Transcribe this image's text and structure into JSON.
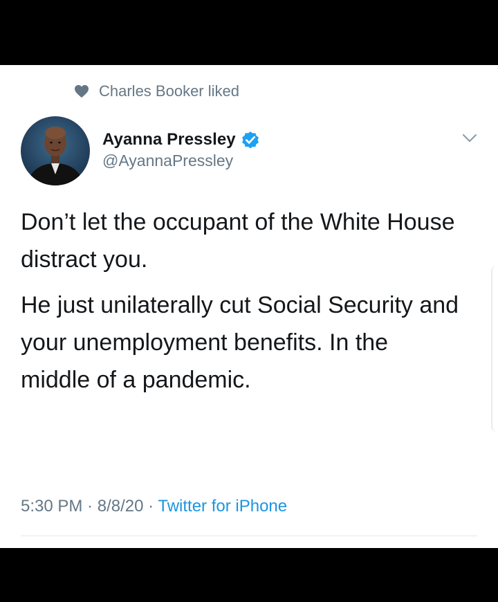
{
  "social_context": {
    "text": "Charles Booker liked",
    "icon": "heart-icon"
  },
  "author": {
    "display_name": "Ayanna Pressley",
    "handle": "@AyannaPressley",
    "verified": true,
    "verified_color": "#1da1f2"
  },
  "tweet": {
    "paragraphs": [
      "Don’t let the occupant of the White House distract you.",
      "He just unilaterally cut Social Security and your unemployment benefits. In the middle of a pandemic."
    ]
  },
  "meta": {
    "time": "5:30 PM",
    "date": "8/8/20",
    "source": "Twitter for iPhone",
    "separator": " · "
  },
  "colors": {
    "text_primary": "#14171a",
    "text_secondary": "#657786",
    "link": "#1b95e0",
    "background": "#ffffff",
    "frame": "#000000"
  }
}
